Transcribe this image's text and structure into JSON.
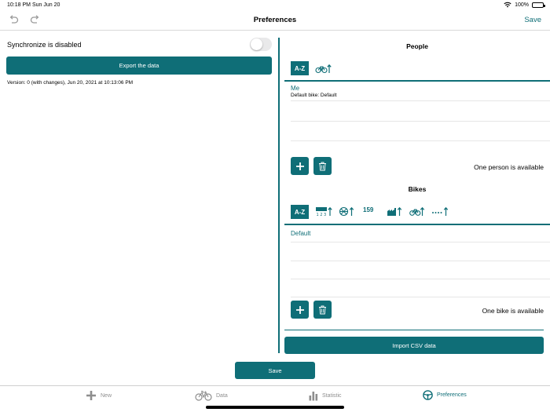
{
  "status_bar": {
    "time": "10:18 PM",
    "date": "Sun Jun 20",
    "battery": "100%"
  },
  "nav": {
    "title": "Preferences",
    "save_label": "Save"
  },
  "left": {
    "sync_label": "Synchronize is disabled",
    "sync_enabled": false,
    "export_label": "Export the data",
    "version_text": "Version: 0 (with changes), Jun 20, 2021 at 10:13:06 PM"
  },
  "people": {
    "title": "People",
    "sort_az": "A-Z",
    "items": [
      {
        "name": "Me",
        "detail": "Default bike: Default"
      }
    ],
    "count_text": "One person is available"
  },
  "bikes": {
    "title": "Bikes",
    "sort_az": "A-Z",
    "sort_number": "159",
    "items": [
      {
        "name": "Default"
      }
    ],
    "count_text": "One bike is available"
  },
  "import_label": "Import CSV data",
  "main_save_label": "Save",
  "tabs": [
    {
      "label": "New",
      "icon": "plus-icon"
    },
    {
      "label": "Data",
      "icon": "bicycle-icon"
    },
    {
      "label": "Statistic",
      "icon": "bar-chart-icon"
    },
    {
      "label": "Preferences",
      "icon": "steering-wheel-icon",
      "active": true
    }
  ],
  "colors": {
    "accent": "#0f6e77",
    "inactive": "#8e8e8e"
  }
}
